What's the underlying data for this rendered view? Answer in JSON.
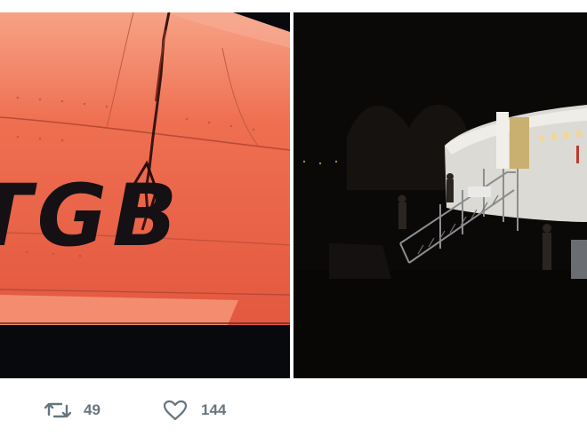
{
  "tweet": {
    "media": [
      {
        "kind": "photo",
        "painted_text": "TGB"
      },
      {
        "kind": "photo"
      }
    ],
    "actions": {
      "retweet": {
        "icon": "retweet-icon",
        "count": "49"
      },
      "like": {
        "icon": "heart-icon",
        "count": "144"
      }
    }
  },
  "colors": {
    "background": "#ffffff",
    "action_gray": "#66757f",
    "wing_orange": "#ef6a4c",
    "lettering": "#141013"
  }
}
